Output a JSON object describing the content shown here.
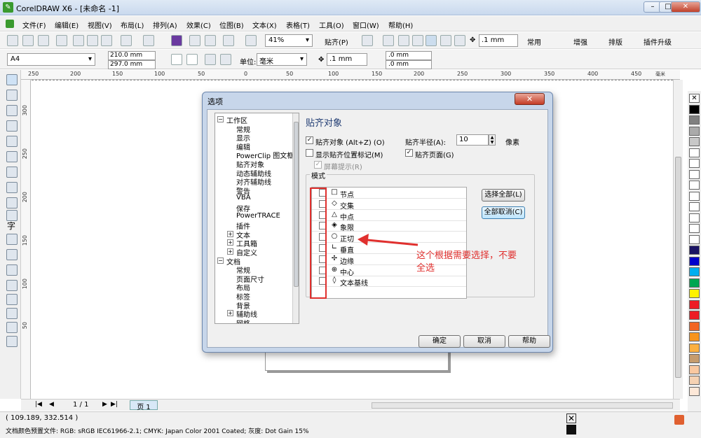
{
  "window": {
    "title": "CorelDRAW X6 - [未命名 -1]",
    "controls": [
      "–",
      "□",
      "✕"
    ]
  },
  "menu": [
    "文件(F)",
    "编辑(E)",
    "视图(V)",
    "布局(L)",
    "排列(A)",
    "效果(C)",
    "位图(B)",
    "文本(X)",
    "表格(T)",
    "工具(O)",
    "窗口(W)",
    "帮助(H)"
  ],
  "toolbar": {
    "zoom": "41%",
    "snap_label": "贴齐(P)",
    "nudge": ".1 mm",
    "right_buttons": [
      "常用",
      "增强",
      "排版",
      "插件升级"
    ]
  },
  "propbar": {
    "page_size": "A4",
    "width": "210.0 mm",
    "height": "297.0 mm",
    "units_label": "单位:",
    "units": "毫米",
    "nudge": ".1 mm",
    "dup_x": ".0 mm",
    "dup_y": ".0 mm"
  },
  "ruler": {
    "h_ticks": [
      "250",
      "200",
      "150",
      "100",
      "50",
      "0",
      "50",
      "100",
      "150",
      "200",
      "250",
      "300",
      "350",
      "400",
      "450"
    ],
    "h_unit": "毫米",
    "v_ticks": [
      "300",
      "250",
      "200",
      "150",
      "100",
      "50"
    ]
  },
  "pagebar": {
    "page_counter": "1 / 1",
    "page_tab": "页 1"
  },
  "status": {
    "coords": "( 109.189, 332.514 )",
    "color_profile": "文档颜色预置文件: RGB: sRGB IEC61966-2.1; CMYK: Japan Color 2001 Coated; 灰度: Dot Gain 15%"
  },
  "palette_colors": [
    "#ffffff",
    "#000000",
    "#808080",
    "#aaaaaa",
    "#c8c8c8",
    "#ffffff",
    "#ffffff",
    "#ffffff",
    "#ffffff",
    "#ffffff",
    "#ffffff",
    "#ffffff",
    "#ffffff",
    "#ffffff",
    "#1b1464",
    "#0000cc",
    "#00aeef",
    "#00a651",
    "#fff200",
    "#ed1c24",
    "#ed1c24",
    "#f26522",
    "#f7941d",
    "#fbb040",
    "#c69c6d",
    "#f9c8a0",
    "#f5d2b3",
    "#fde8d8"
  ],
  "dialog": {
    "title": "选项",
    "close": "✕",
    "tree": [
      {
        "label": "工作区",
        "level": 0,
        "exp": "−"
      },
      {
        "label": "常规",
        "level": 1
      },
      {
        "label": "显示",
        "level": 1
      },
      {
        "label": "编辑",
        "level": 1
      },
      {
        "label": "PowerClip 图文框",
        "level": 1
      },
      {
        "label": "贴齐对象",
        "level": 1
      },
      {
        "label": "动态辅助线",
        "level": 1
      },
      {
        "label": "对齐辅助线",
        "level": 1
      },
      {
        "label": "警告",
        "level": 1
      },
      {
        "label": "VBA",
        "level": 1
      },
      {
        "label": "保存",
        "level": 1
      },
      {
        "label": "PowerTRACE",
        "level": 1
      },
      {
        "label": "插件",
        "level": 1
      },
      {
        "label": "文本",
        "level": 1,
        "exp": "+"
      },
      {
        "label": "工具箱",
        "level": 1,
        "exp": "+"
      },
      {
        "label": "自定义",
        "level": 1,
        "exp": "+"
      },
      {
        "label": "文档",
        "level": 0,
        "exp": "−"
      },
      {
        "label": "常规",
        "level": 1
      },
      {
        "label": "页面尺寸",
        "level": 1
      },
      {
        "label": "布局",
        "level": 1
      },
      {
        "label": "标签",
        "level": 1
      },
      {
        "label": "背景",
        "level": 1
      },
      {
        "label": "辅助线",
        "level": 1,
        "exp": "+"
      },
      {
        "label": "网格",
        "level": 1
      }
    ],
    "panel_title": "贴齐对象",
    "snap_objects": {
      "label": "贴齐对象 (Alt+Z) (O)",
      "checked": true
    },
    "snap_radius_label": "贴齐半径(A):",
    "snap_radius_value": "10",
    "snap_radius_unit": "像素",
    "show_marker": {
      "label": "显示贴齐位置标记(M)",
      "checked": false
    },
    "snap_page": {
      "label": "贴齐页面(G)",
      "checked": true
    },
    "screen_tip": {
      "label": "屏幕提示(R)",
      "checked": true
    },
    "mode_label": "模式",
    "modes": [
      {
        "symbol": "□",
        "label": "节点"
      },
      {
        "symbol": "◇",
        "label": "交集"
      },
      {
        "symbol": "△",
        "label": "中点"
      },
      {
        "symbol": "◈",
        "label": "象限"
      },
      {
        "symbol": "○",
        "label": "正切"
      },
      {
        "symbol": "∟",
        "label": "垂直"
      },
      {
        "symbol": "✢",
        "label": "边缘"
      },
      {
        "symbol": "⊕",
        "label": "中心"
      },
      {
        "symbol": "◊",
        "label": "文本基线"
      }
    ],
    "select_all": "选择全部(L)",
    "deselect_all": "全部取消(C)",
    "ok": "确定",
    "cancel": "取消",
    "help": "帮助"
  },
  "annotation": "这个根据需要选择，不要全选"
}
